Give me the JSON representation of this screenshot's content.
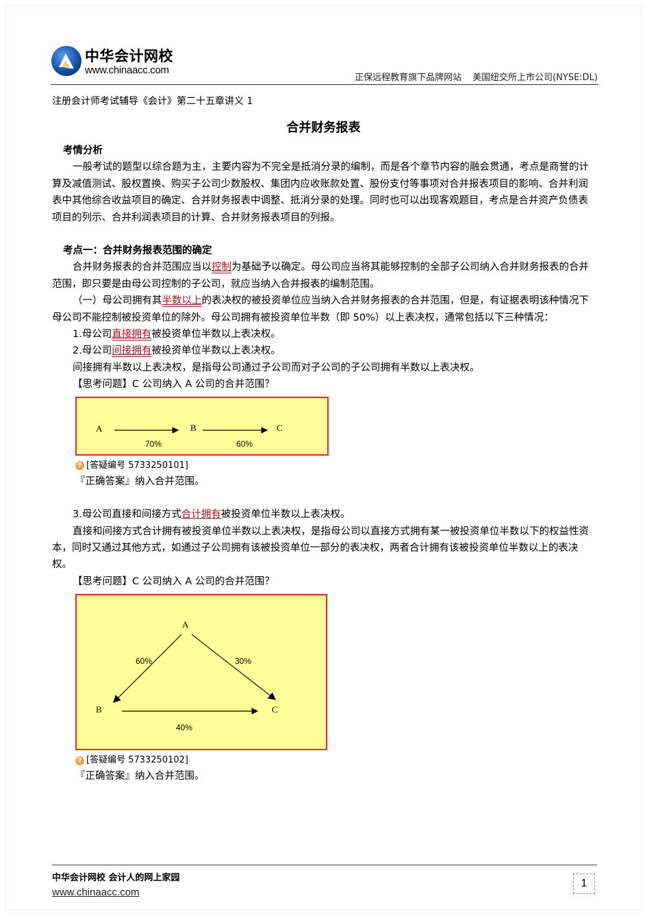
{
  "header": {
    "brand_name": "中华会计网校",
    "brand_url": "www.chinaacc.com",
    "tagline_left": "正保远程教育旗下品牌网站",
    "tagline_right": "美国纽交所上市公司(NYSE:DL)",
    "logo_icon": "chinaacc-logo-icon"
  },
  "doc": {
    "subtitle": "注册会计师考试辅导《会计》第二十五章讲义 1",
    "title": "合并财务报表"
  },
  "section1": {
    "heading": "考情分析",
    "paragraph": "一般考试的题型以综合题为主，主要内容为不完全是抵消分录的编制，而是各个章节内容的融会贯通，考点是商誉的计算及减值测试、股权置换、购买子公司少数股权、集团内应收账款处置、股份支付等事项对合并报表项目的影响、合并利润表中其他综合收益项目的确定、合并财务报表中调整、抵消分录的处理。同时也可以出现客观题目，考点是合并资产负债表项目的列示、合并利润表项目的计算、合并财务报表项目的列报。"
  },
  "section2": {
    "heading": "考点一：合并财务报表范围的确定",
    "p1_pre": "合并财务报表的合并范围应当以",
    "p1_kw": "控制",
    "p1_post": "为基础予以确定。母公司应当将其能够控制的全部子公司纳入合并财务报表的合并范围，即只要是由母公司控制的子公司，就应当纳入合并报表的编制范围。",
    "p2_pre": "（一）母公司拥有其",
    "p2_kw": "半数以上",
    "p2_post": "的表决权的被投资单位应当纳入合并财务报表的合并范围，但是，有证据表明该种情况下母公司不能控制被投资单位的除外。母公司拥有被投资单位半数（即 50%）以上表决权，通常包括以下三种情况：",
    "item1_pre": "1.母公司",
    "item1_kw": "直接拥有",
    "item1_post": "被投资单位半数以上表决权。",
    "item2_pre": "2.母公司",
    "item2_kw": "间接拥有",
    "item2_post": "被投资单位半数以上表决权。",
    "item2_explain": "间接拥有半数以上表决权，是指母公司通过子公司而对子公司的子公司拥有半数以上表决权。",
    "question1": "【思考问题】C 公司纳入 A 公司的合并范围？",
    "diagram1": {
      "nodes": [
        "A",
        "B",
        "C"
      ],
      "edges": [
        {
          "from": "A",
          "to": "B",
          "label": "70%"
        },
        {
          "from": "B",
          "to": "C",
          "label": "60%"
        }
      ]
    },
    "answer_id1": "[答疑编号 5733250101]",
    "answer1": "『正确答案』纳入合并范围。",
    "item3_pre": "3.母公司直接和间接方式",
    "item3_kw": "合计拥有",
    "item3_post": "被投资单位半数以上表决权。",
    "item3_explain": "直接和间接方式合计拥有被投资单位半数以上表决权，是指母公司以直接方式拥有某一被投资单位半数以下的权益性资本，同时又通过其他方式，如通过子公司拥有该被投资单位一部分的表决权，两者合计拥有该被投资单位半数以上的表决权。",
    "question2": "【思考问题】C 公司纳入 A 公司的合并范围？",
    "diagram2": {
      "nodes": [
        "A",
        "B",
        "C"
      ],
      "edges": [
        {
          "from": "A",
          "to": "B",
          "label": "60%"
        },
        {
          "from": "A",
          "to": "C",
          "label": "30%"
        },
        {
          "from": "B",
          "to": "C",
          "label": "40%"
        }
      ]
    },
    "answer_id2": "[答疑编号 5733250102]",
    "answer2": "『正确答案』纳入合并范围。"
  },
  "footer": {
    "brand": "中华会计网校  会计人的网上家园",
    "url": "www.chinaacc.com",
    "page_number": "1"
  },
  "colors": {
    "keyword": "#a0151f",
    "diagram_bg": "#ffff99",
    "diagram_border": "#ff2020"
  }
}
